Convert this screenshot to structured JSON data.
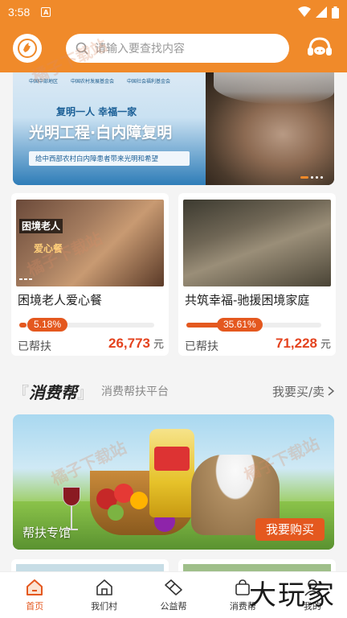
{
  "status_bar": {
    "time": "3:58",
    "app_badge": "A"
  },
  "header": {
    "search_placeholder": "请输入要查找内容"
  },
  "banner": {
    "org_labels": [
      "中国中部地区",
      "中国农村发展基金会",
      "中国社会福利基金会"
    ],
    "slogan": "复明一人 幸福一家",
    "title": "光明工程·白内障复明",
    "subtitle": "给中西部农村白内障患者带来光明和希望"
  },
  "projects": [
    {
      "title": "困境老人爱心餐",
      "image_text_1": "困境老人",
      "image_text_2": "爱心餐",
      "progress_label": "5.18%",
      "progress_value": 5.18,
      "helped_label": "已帮扶",
      "amount": "26,773",
      "unit": "元"
    },
    {
      "title": "共筑幸福-驰援困境家庭",
      "progress_label": "35.61%",
      "progress_value": 35.61,
      "helped_label": "已帮扶",
      "amount": "71,228",
      "unit": "元"
    }
  ],
  "section": {
    "title": "消费帮",
    "subtitle": "消费帮扶平台",
    "more": "我要买/卖"
  },
  "consumer_banner": {
    "label": "帮扶专馆",
    "button": "我要购买"
  },
  "watermark": "橘子下载站",
  "tabs": [
    {
      "label": "首页",
      "icon": "home-icon",
      "active": true
    },
    {
      "label": "我们村",
      "icon": "village-icon",
      "active": false
    },
    {
      "label": "公益帮",
      "icon": "handshake-icon",
      "active": false
    },
    {
      "label": "消费帮",
      "icon": "shopping-bag-icon",
      "active": false
    },
    {
      "label": "我的",
      "icon": "user-icon",
      "active": false
    }
  ],
  "brand_watermark": "大玩家",
  "colors": {
    "primary": "#f08a2a",
    "accent": "#e4581f",
    "amount": "#e4431f"
  }
}
